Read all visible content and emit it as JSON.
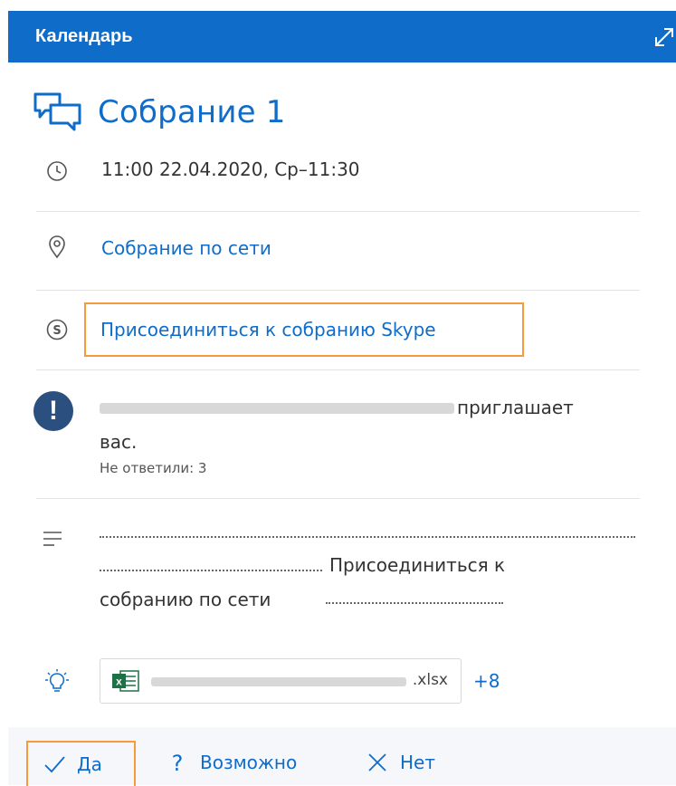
{
  "header": {
    "title": "Календарь"
  },
  "event": {
    "title": "Собрание 1",
    "time": "11:00 22.04.2020, Ср–11:30",
    "location": "Собрание по сети",
    "skype_link": "Присоединиться к собранию Skype",
    "invite_text": "приглашает",
    "invite_text2": "вас.",
    "no_reply": "Не ответили: 3",
    "description": {
      "line2_text": "Присоединиться к",
      "line3_text": "собранию по сети"
    },
    "attachment": {
      "extension": ".xlsx",
      "more_count": "+8"
    }
  },
  "actions": {
    "yes": "Да",
    "maybe": "Возможно",
    "no": "Нет"
  },
  "colors": {
    "accent": "#0f6cc8",
    "highlight": "#f59b3c",
    "header_bg": "#0f6cc8"
  }
}
